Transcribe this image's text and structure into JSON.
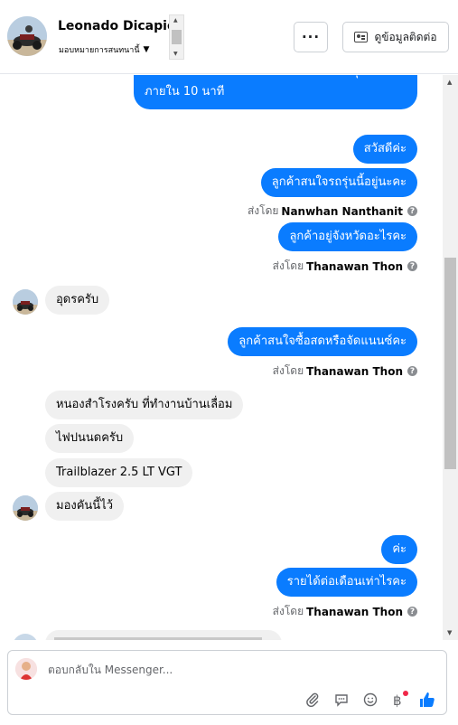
{
  "header": {
    "name": "Leonado Dicapio",
    "assign_label": "มอบหมายการสนทนานี้",
    "more_label": "···",
    "contact_label": "ดูข้อมูลติดต่อ"
  },
  "messages": {
    "partial_top": "โทรติดต่อไว้ได้เลย พนักงานจะติดต่อกลับคุณ",
    "partial_top_line2": "ภายใน 10 นาที",
    "m1": "สวัสดีค่ะ",
    "m2": "ลูกค้าสนใจรถรุ่นนี้อยู่นะคะ",
    "sent1_prefix": "ส่งโดย",
    "sent1_name": "Nanwhan Nanthanit",
    "m3": "ลูกค้าอยู่จังหวัดอะไรคะ",
    "sent2_prefix": "ส่งโดย",
    "sent2_name": "Thanawan Thon",
    "in1": "อุดรครับ",
    "m4": "ลูกค้าสนใจซื้อสดหรือจัดแนนซ์คะ",
    "sent3_prefix": "ส่งโดย",
    "sent3_name": "Thanawan Thon",
    "in2": "หนองสำโรงครับ  ที่ทำงานบ้านเลื่อม",
    "in3": "ไฟปนนดครับ",
    "in4": "Trailblazer 2.5 LT VGT",
    "in5": "มองคันนี้ไว้",
    "m5": "ค่ะ",
    "m6": "รายได้ต่อเดือนเท่าไรคะ",
    "sent4_prefix": "ส่งโดย",
    "sent4_name": "Thanawan Thon"
  },
  "composer": {
    "placeholder": "ตอบกลับใน Messenger..."
  },
  "colors": {
    "outgoing_bubble": "#0a7cff",
    "incoming_bubble": "#f0f0f0",
    "like_icon": "#0a7cff"
  }
}
